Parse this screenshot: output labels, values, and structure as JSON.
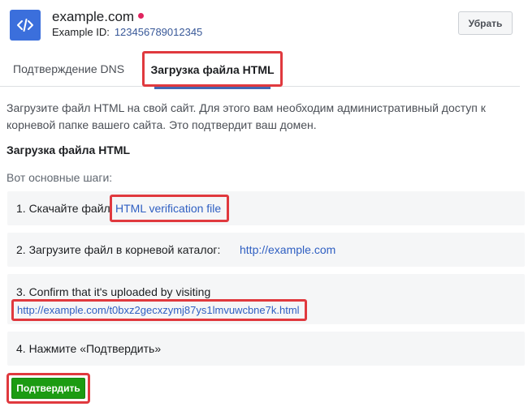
{
  "header": {
    "domain": "example.com",
    "business_name": "Example",
    "id_label": "ID:",
    "id_value": "123456789012345",
    "remove_label": "Убрать",
    "status_color": "#e0245e",
    "app_icon": "code-icon"
  },
  "tabs": [
    {
      "label": "Подтверждение DNS",
      "active": false
    },
    {
      "label": "Загрузка файла HTML",
      "active": true
    }
  ],
  "content": {
    "intro": "Загрузите файл HTML на свой сайт. Для этого вам необходим административный доступ к корневой папке вашего сайта. Это подтвердит ваш домен.",
    "section_title": "Загрузка файла HTML",
    "steps_intro": "Вот основные шаги:",
    "steps": [
      {
        "text": "1. Скачайте файл",
        "link": "HTML verification file"
      },
      {
        "text": "2. Загрузите файл в корневой каталог:",
        "link": "http://example.com"
      },
      {
        "text": "3. Confirm that it's uploaded by visiting",
        "link": "http://example.com/t0bxz2gecxzymj87ys1lmvuwcbne7k.html"
      },
      {
        "text": "4. Нажмите «Подтвердить»"
      }
    ],
    "confirm_label": "Подтвердить"
  },
  "colors": {
    "accent": "#4267b2",
    "link": "#2f5fc2",
    "confirm": "#1c9b12",
    "highlight": "#e0393e"
  }
}
